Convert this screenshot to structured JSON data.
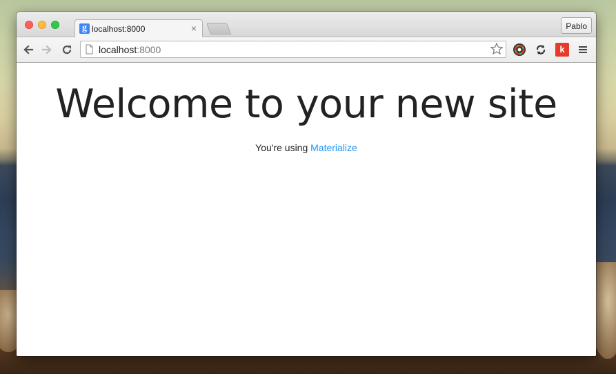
{
  "browser": {
    "tab": {
      "favicon_letter": "g",
      "title": "localhost:8000",
      "close_glyph": "×"
    },
    "profile_name": "Pablo",
    "address": {
      "host": "localhost",
      "port": ":8000"
    },
    "icons": {
      "back": "arrow-left-icon",
      "forward": "arrow-right-icon",
      "reload": "reload-icon",
      "page": "page-icon",
      "bookmark": "star-icon",
      "ext1": "color-picker-icon",
      "ext2": "sync-icon",
      "ext3": "k-extension-icon",
      "menu": "hamburger-menu-icon"
    },
    "ext3_letter": "k"
  },
  "page": {
    "heading": "Welcome to your new site",
    "subline_prefix": "You're using ",
    "subline_link": "Materialize"
  },
  "colors": {
    "link": "#2196f3",
    "favicon": "#4285f4",
    "k_extension": "#e53b2c"
  }
}
